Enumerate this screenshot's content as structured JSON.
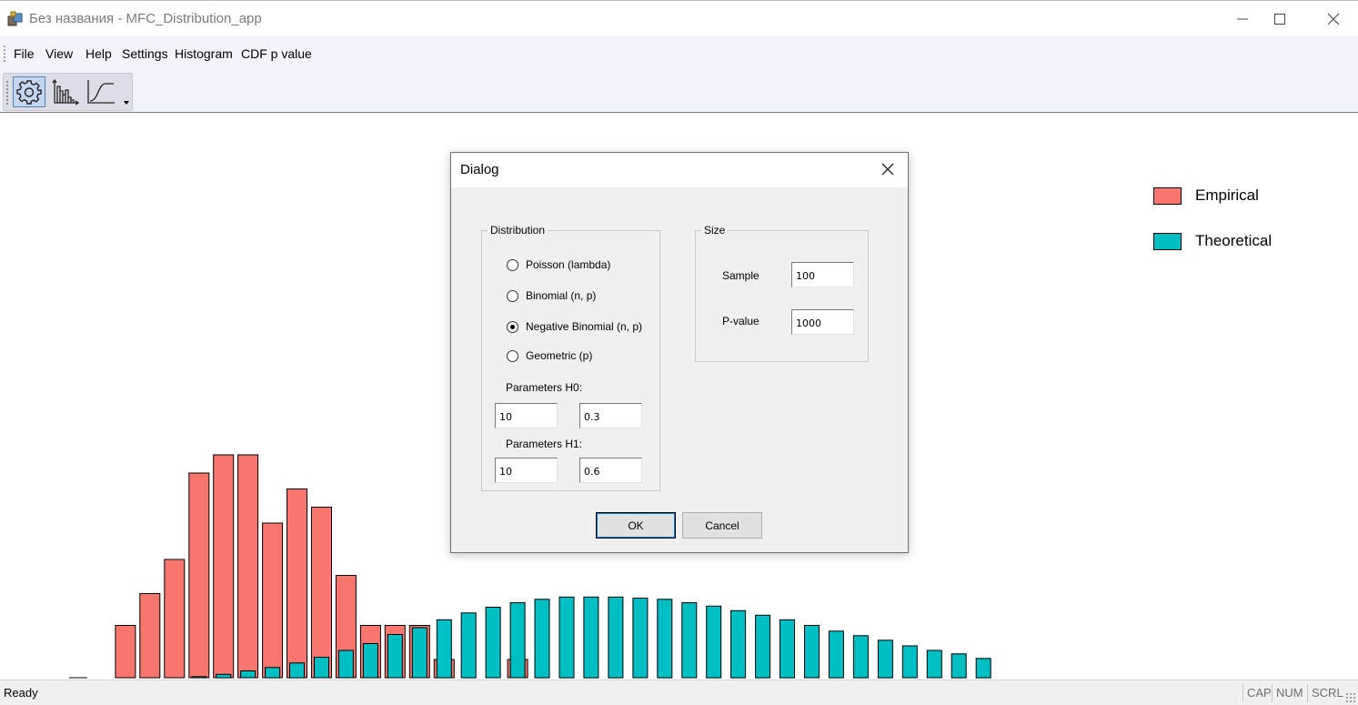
{
  "window": {
    "title": "Без названия - MFC_Distribution_app"
  },
  "menu": [
    "File",
    "View",
    "Help",
    "Settings",
    "Histogram",
    "CDF p value"
  ],
  "toolbar": {
    "buttons": [
      "settings-gear-icon",
      "histogram-icon",
      "cdf-curve-icon"
    ]
  },
  "chart_data": {
    "type": "bar",
    "legend": [
      "Empirical",
      "Theoretical"
    ],
    "colors": {
      "Empirical": "#f8766d",
      "Theoretical": "#00bfc4"
    },
    "legend_position": "top-right",
    "bin_count": 38,
    "series": [
      {
        "name": "Empirical",
        "values": [
          0,
          0,
          0.23,
          0.37,
          0.52,
          0.9,
          0.98,
          0.98,
          0.68,
          0.83,
          0.75,
          0.45,
          0.23,
          0.23,
          0.23,
          0.08,
          0,
          0,
          0.08,
          0,
          0,
          0,
          0,
          0,
          0,
          0,
          0,
          0,
          0,
          0,
          0,
          0,
          0,
          0,
          0,
          0,
          0,
          0
        ]
      },
      {
        "name": "Theoretical",
        "values": [
          0,
          0,
          0,
          0,
          0,
          0.005,
          0.015,
          0.03,
          0.045,
          0.065,
          0.09,
          0.12,
          0.15,
          0.19,
          0.22,
          0.255,
          0.285,
          0.31,
          0.33,
          0.345,
          0.355,
          0.355,
          0.355,
          0.35,
          0.345,
          0.33,
          0.315,
          0.295,
          0.275,
          0.255,
          0.23,
          0.205,
          0.185,
          0.165,
          0.14,
          0.12,
          0.105,
          0.085
        ]
      }
    ]
  },
  "dialog": {
    "title": "Dialog",
    "distribution_group": "Distribution",
    "options": [
      "Poisson (lambda)",
      "Binomial (n, p)",
      "Negative Binomial (n, p)",
      "Geometric (p)"
    ],
    "selected_option": "Negative Binomial (n, p)",
    "params_h0_label": "Parameters H0:",
    "params_h0": [
      "10",
      "0.3"
    ],
    "params_h1_label": "Parameters H1:",
    "params_h1": [
      "10",
      "0.6"
    ],
    "size_group": "Size",
    "sample_label": "Sample",
    "sample_value": "100",
    "pvalue_label": "P-value",
    "pvalue_value": "1000",
    "ok_label": "OK",
    "cancel_label": "Cancel"
  },
  "status": {
    "text": "Ready",
    "indicators": [
      "CAP",
      "NUM",
      "SCRL"
    ]
  }
}
